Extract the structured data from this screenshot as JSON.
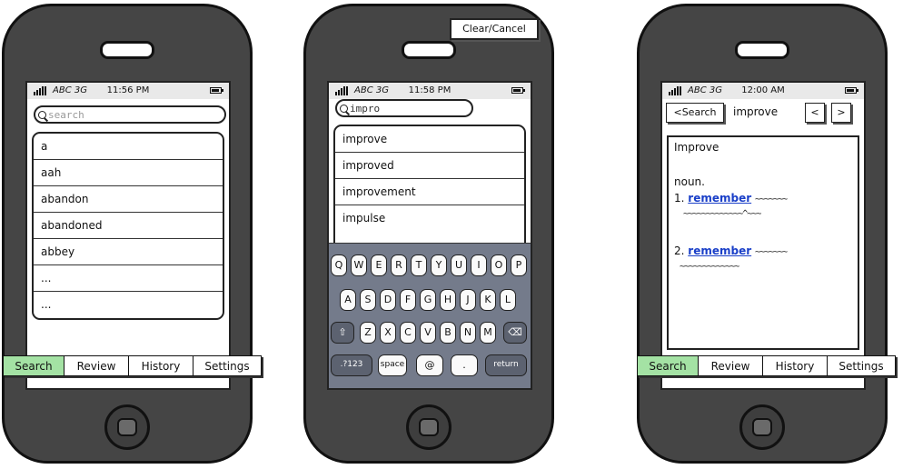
{
  "status": {
    "carrier": "ABC 3G"
  },
  "phones": [
    {
      "time": "11:56 PM",
      "search_placeholder": "search",
      "list": [
        "a",
        "aah",
        "abandon",
        "abandoned",
        "abbey",
        "...",
        "..."
      ],
      "tabs": [
        "Search",
        "Review",
        "History",
        "Settings"
      ],
      "active_tab": "Search"
    },
    {
      "time": "11:58 PM",
      "search_value": "impro",
      "clear_label": "Clear/Cancel",
      "list": [
        "improve",
        "improved",
        "improvement",
        "impulse"
      ],
      "keyboard": {
        "row1": [
          "Q",
          "W",
          "E",
          "R",
          "T",
          "Y",
          "U",
          "I",
          "O",
          "P"
        ],
        "row2": [
          "A",
          "S",
          "D",
          "F",
          "G",
          "H",
          "J",
          "K",
          "L"
        ],
        "row3": [
          "Z",
          "X",
          "C",
          "V",
          "B",
          "N",
          "M"
        ],
        "row4": [
          ".?123",
          "space",
          "@",
          ".",
          "return"
        ]
      }
    },
    {
      "time": "12:00 AM",
      "back_label": "<Search",
      "title": "improve",
      "prev_label": "<",
      "next_label": ">",
      "definition": {
        "heading": "Improve",
        "pos": "noun.",
        "senses": [
          {
            "num": "1.",
            "link": "remember",
            "tail": "~~~~~~~",
            "line2": "~~~~~~~~~~~~~^~~~"
          },
          {
            "num": "2.",
            "link": "remember",
            "tail": "~~~~~~~",
            "line2": "~~~~~~~~~~~~~"
          }
        ]
      },
      "tabs": [
        "Search",
        "Review",
        "History",
        "Settings"
      ],
      "active_tab": "Search"
    }
  ],
  "colors": {
    "active_tab": "#a4e2a4",
    "keyboard": "#747b8b",
    "phone_body": "#454545",
    "link": "#1a3fc8"
  },
  "icons": [
    "signal-icon",
    "battery-icon",
    "search-icon",
    "shift-icon",
    "backspace-icon"
  ]
}
